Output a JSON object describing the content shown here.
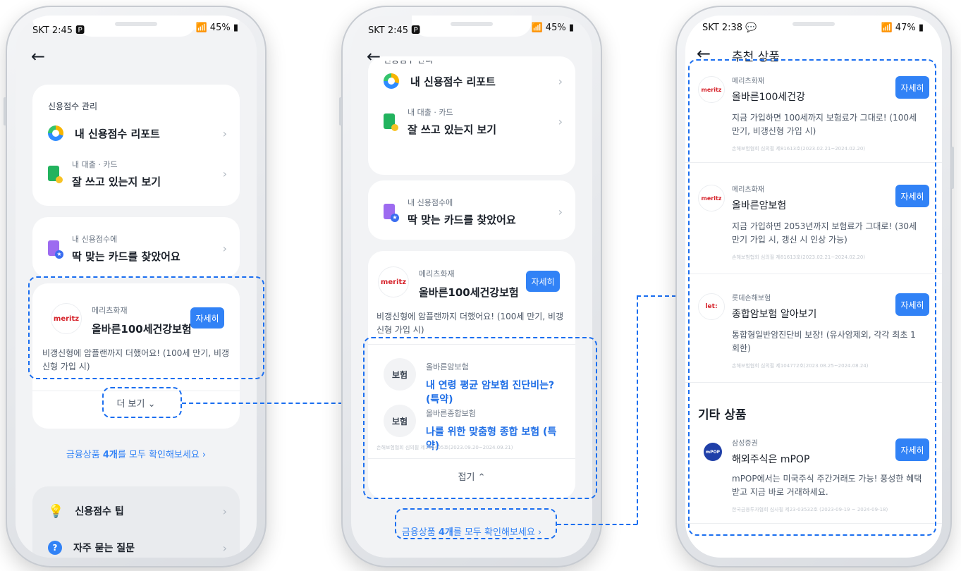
{
  "phone1": {
    "status_left": "SKT 2:45 🅿",
    "status_right": "45%",
    "credit_card": {
      "header": "신용점수 관리",
      "item1_title": "내 신용점수 리포트",
      "item2_sub": "내 대출 · 카드",
      "item2_title": "잘 쓰고 있는지 보기"
    },
    "match_card": {
      "sub": "내 신용점수에",
      "title": "딱 맞는 카드를 찾았어요"
    },
    "product": {
      "logo": "meritz",
      "company": "메리츠화재",
      "name": "올바른100세건강보험",
      "button": "자세히",
      "description": "비갱신형에 암플랜까지 더했어요! (100세 만기, 비갱신형 가입 시)"
    },
    "more_button": "더 보기",
    "all_products_prefix": "금융상품 ",
    "all_products_bold": "4개",
    "all_products_suffix": "를 모두 확인해보세요 ›",
    "tip": "신용점수 팁",
    "faq": "자주 묻는 질문"
  },
  "phone2": {
    "status_left": "SKT 2:45 🅿",
    "status_right": "45%",
    "credit_card": {
      "header": "신용점수 관리",
      "item1_title": "내 신용점수 리포트",
      "item2_sub": "내 대출 · 카드",
      "item2_title": "잘 쓰고 있는지 보기"
    },
    "match_card": {
      "sub": "내 신용점수에",
      "title": "딱 맞는 카드를 찾았어요"
    },
    "product": {
      "logo": "meritz",
      "company": "메리츠화재",
      "name": "올바른100세건강보험",
      "button": "자세히",
      "description": "비갱신형에 암플랜까지 더했어요! (100세 만기, 비갱신형 가입 시)"
    },
    "extras": [
      {
        "tag": "보험",
        "sub": "올바른암보험",
        "title": "내 연령 평균 암보험 진단비는? (특약)"
      },
      {
        "tag": "보험",
        "sub": "올바른종합보험",
        "title": "나를 위한 맞춤형 종합 보험 (특약)"
      }
    ],
    "fine_print": "손해보험협회 심의필 제106405호(2023.09.20~2024.09.21)",
    "collapse_button": "접기",
    "all_products_prefix": "금융상품 ",
    "all_products_bold": "4개",
    "all_products_suffix": "를 모두 확인해보세요 ›"
  },
  "phone3": {
    "status_left": "SKT 2:38 💬",
    "status_right": "47%",
    "title": "추천 상품",
    "products": [
      {
        "logo": "meritz",
        "company": "메리츠화재",
        "name": "올바른100세건강",
        "button": "자세히",
        "description": "지금 가입하면 100세까지 보험료가 그대로! (100세 만기, 비갱신형 가입 시)",
        "fine": "손해보험협회 심의필 제81613호(2023.02.21~2024.02.20)"
      },
      {
        "logo": "meritz",
        "company": "메리츠화재",
        "name": "올바른암보험",
        "button": "자세히",
        "description": "지금 가입하면 2053년까지 보험료가 그대로! (30세 만기 가입 시, 갱신 시 인상 가능)",
        "fine": "손해보험협회 심의필 제81613호(2023.02.21~2024.02.20)"
      },
      {
        "logo": "let:",
        "company": "롯데손해보험",
        "name": "종합암보험 알아보기",
        "button": "자세히",
        "description": "통합형일반암진단비 보장! (유사암제외, 각각 최초 1회한)",
        "fine": "손해보험협회 심의필 제104772호(2023.08.25~2024.08.24)"
      }
    ],
    "other_section": "기타 상품",
    "other_product": {
      "logo": "mPOP",
      "company": "삼성증권",
      "name": "해외주식은 mPOP",
      "button": "자세히",
      "description": "mPOP에서는 미국주식 주간거래도 가능! 풍성한 혜택 받고 지금 바로 거래하세요.",
      "fine": "한국금융투자협회 심사필 제23-03532호 (2023-09-19 ~ 2024-09-18)"
    }
  },
  "colors": {
    "accent": "#3182f6",
    "dash": "#1a6ef0",
    "brand_red": "#d6222a"
  }
}
